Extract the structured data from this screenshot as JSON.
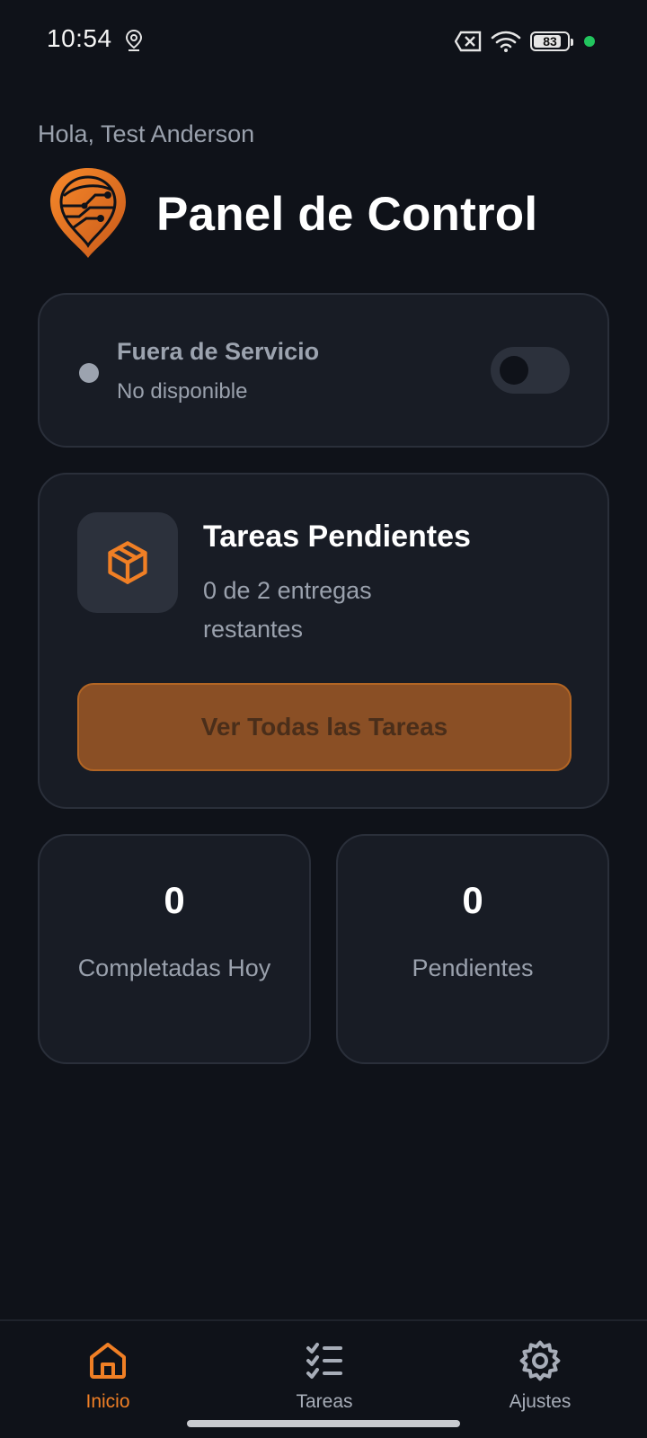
{
  "status_bar": {
    "time": "10:54",
    "battery_level": "83",
    "battery_fraction": 0.83,
    "icons": [
      "location-icon",
      "no-sim-icon",
      "wifi-icon",
      "battery-icon"
    ]
  },
  "header": {
    "greeting": "Hola, Test Anderson",
    "title": "Panel de Control"
  },
  "service_status": {
    "title": "Fuera de Servicio",
    "subtitle": "No disponible",
    "toggle_on": false
  },
  "pending_tasks": {
    "title": "Tareas Pendientes",
    "subtitle": "0 de 2 entregas restantes",
    "button_label": "Ver Todas las Tareas"
  },
  "stats": [
    {
      "value": "0",
      "label": "Completadas Hoy"
    },
    {
      "value": "0",
      "label": "Pendientes"
    }
  ],
  "nav": {
    "items": [
      {
        "label": "Inicio",
        "icon": "home-icon",
        "active": true
      },
      {
        "label": "Tareas",
        "icon": "checklist-icon",
        "active": false
      },
      {
        "label": "Ajustes",
        "icon": "gear-icon",
        "active": false
      }
    ]
  },
  "colors": {
    "background": "#0f1219",
    "card": "#181c25",
    "accent": "#f07f25",
    "button": "#8a4f25",
    "status_online_dot": "#22c55e"
  }
}
